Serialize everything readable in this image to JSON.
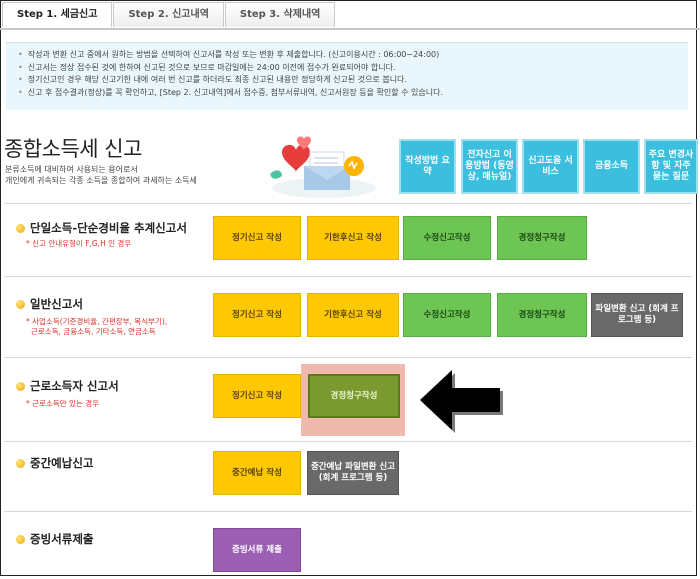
{
  "tabs": [
    {
      "label": "Step 1. 세금신고"
    },
    {
      "label": "Step 2. 신고내역"
    },
    {
      "label": "Step 3. 삭제내역"
    }
  ],
  "notice": [
    "작성과 변환 신고 중에서 원하는 방법을 선택하여 신고서를 작성 또는 변환 후 제출합니다. (신고이용시간 : 06:00~24:00)",
    "신고서는 정상 접수된 것에 한하여 신고된 것으로 보므로 마감일에는 24:00 이전에 접수가 완료되어야 합니다.",
    "정기신고인 경우 해당 신고기한 내에 여러 번 신고를 하더라도 최종 신고된 내용만 정당하게 신고된 것으로 봅니다.",
    "신고 후 접수결과(정상)를 꼭 확인하고, [Step 2. 신고내역]에서 접수증, 첨부서류내역, 신고서원장 등을 확인할 수 있습니다."
  ],
  "header": {
    "title": "종합소득세 신고",
    "desc_line1": "분류소득에 대비하여 사용되는 용어로서",
    "desc_line2": "개인에게 귀속되는 각종 소득을 종합하여 과세하는 소득세"
  },
  "quick_links": [
    {
      "label": "작성방법 요약"
    },
    {
      "label": "전자신고 이용방법 (동영상, 매뉴얼)"
    },
    {
      "label": "신고도움 서비스"
    },
    {
      "label": "금융소득"
    },
    {
      "label": "주요 변경사항 및 자주 묻는 질문"
    }
  ],
  "sections": [
    {
      "title": "단일소득-단순경비율 추계신고서",
      "note": "* 신고 안내유형이 F,G,H 인 경우",
      "buttons": [
        "정기신고 작성",
        "기한후신고 작성",
        "수정신고작성",
        "경정청구작성"
      ]
    },
    {
      "title": "일반신고서",
      "note_line1": "* 사업소득(기준경비율, 간편장부, 복식부기),",
      "note_line2": "근로소득, 금융소득, 기타소득, 연금소득",
      "buttons": [
        "정기신고 작성",
        "기한후신고 작성",
        "수정신고작성",
        "경정청구작성",
        "파일변환 신고 (회계 프로그램 등)"
      ]
    },
    {
      "title": "근로소득자 신고서",
      "note": "* 근로소득만 있는 경우",
      "buttons": [
        "정기신고 작성",
        "경정청구작성"
      ]
    },
    {
      "title": "중간예납신고",
      "buttons": [
        "중간예납 작성",
        "중간예납 파일변환 신고 (회계 프로그램 등)"
      ]
    },
    {
      "title": "증빙서류제출",
      "buttons": [
        "증빙서류 제출"
      ]
    }
  ],
  "colors": {
    "yellow": "#ffc805",
    "green": "#6dc553",
    "gray": "#696969",
    "purple": "#9b5fb4",
    "quick": "#3cbfdf",
    "highlight": "#f0b9ad"
  }
}
